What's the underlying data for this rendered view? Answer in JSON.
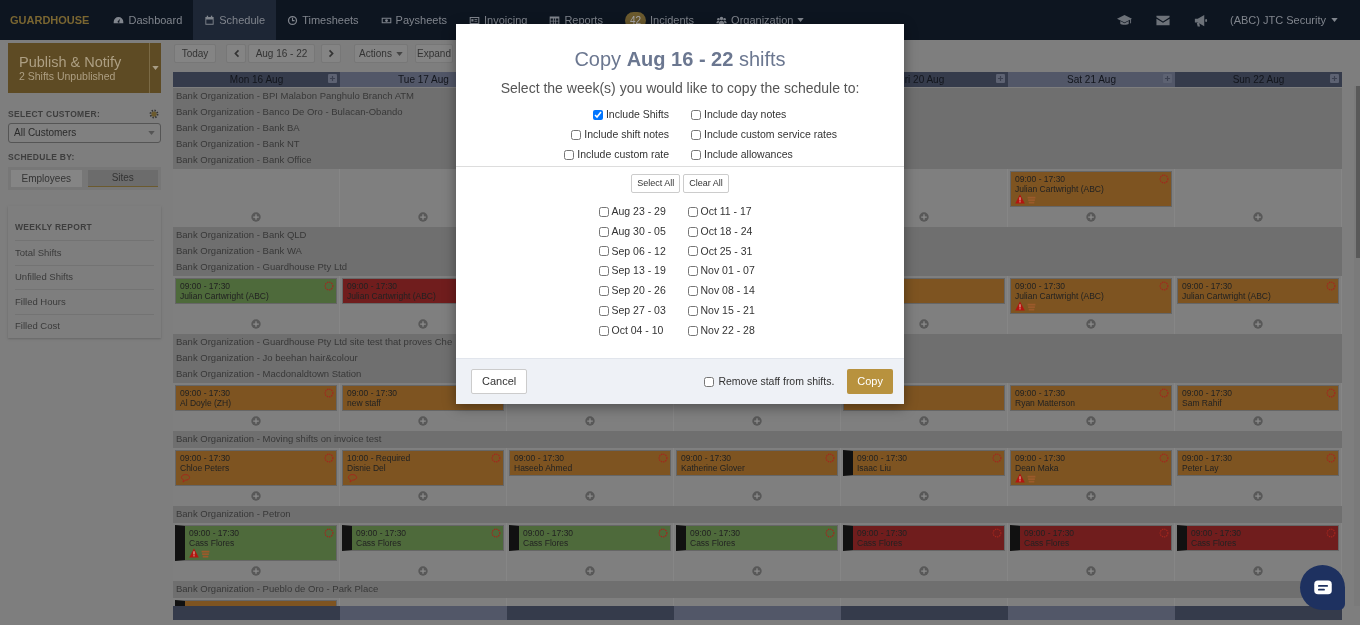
{
  "navbar": {
    "logo": "GUARDHOUSE",
    "items": [
      {
        "label": "Dashboard",
        "selected": false
      },
      {
        "label": "Schedule",
        "selected": true
      },
      {
        "label": "Timesheets",
        "selected": false
      },
      {
        "label": "Paysheets",
        "selected": false
      },
      {
        "label": "Invoicing",
        "selected": false
      },
      {
        "label": "Reports",
        "selected": false
      },
      {
        "label": "Incidents",
        "badge": "42",
        "selected": false
      },
      {
        "label": "Organization",
        "dropdown": true,
        "selected": false
      }
    ],
    "account": "(ABC) JTC Security"
  },
  "sidebar": {
    "publish": {
      "title": "Publish & Notify",
      "subtitle": "2 Shifts Unpublished"
    },
    "customer_label": "SELECT CUSTOMER:",
    "customer_select": "All Customers",
    "schedule_by_label": "SCHEDULE BY:",
    "schedule_by": [
      {
        "label": "Employees",
        "selected": false
      },
      {
        "label": "Sites",
        "selected": true
      }
    ],
    "weekly_report": {
      "title": "WEEKLY REPORT",
      "items": [
        "Total Shifts",
        "Unfilled Shifts",
        "Filled Hours",
        "Filled Cost"
      ]
    }
  },
  "toolbar": {
    "today": "Today",
    "range": "Aug 16 - 22",
    "actions": "Actions",
    "expand": "Expand"
  },
  "schedule": {
    "days_left": [
      {
        "label": "Mon 16 Aug",
        "toggle": true
      },
      {
        "label": "Tue 17 Aug"
      }
    ],
    "days_right": [
      {
        "label": "ri 20 Aug",
        "toggle": true
      },
      {
        "label": "Sat 21 Aug",
        "toggle": true
      },
      {
        "label": "Sun 22 Aug",
        "toggle": true
      }
    ],
    "groups": [
      {
        "sites": [
          "Bank Organization - BPI Malabon Panghulo Branch ATM",
          "Bank Organization - Banco De Oro - Bulacan-Obando",
          "Bank Organization - Bank BA",
          "Bank Organization - Bank NT",
          "Bank Organization - Bank Office"
        ],
        "cells": [
          {
            "add": true
          },
          {
            "add": true
          },
          {},
          {},
          {
            "add": true
          },
          {
            "add": true,
            "shift": {
              "time": "09:00 - 17:30",
              "name": "Julian Cartwright (ABC)",
              "color": "#7e5421",
              "marked": false,
              "warning": true,
              "note": false
            }
          },
          {
            "add": true
          }
        ]
      },
      {
        "sites": [
          "Bank Organization - Bank QLD",
          "Bank Organization - Bank WA",
          "Bank Organization - Guardhouse Pty Ltd"
        ],
        "cells": [
          {
            "add": true,
            "shift": {
              "time": "09:00 - 17:30",
              "name": "Julian Cartwright (ABC)",
              "color": "#4e6a3b",
              "marked": false,
              "warning": false,
              "note": false
            }
          },
          {
            "add": true,
            "shift": {
              "time": "09:00 - 17:30",
              "name": "Julian Cartwright (ABC)",
              "color": "#701d1d",
              "marked": false,
              "warning": false,
              "note": false,
              "flagged": false
            }
          },
          {},
          {},
          {
            "add": true,
            "shift": {
              "color": "#7e5421"
            }
          },
          {
            "add": true,
            "shift": {
              "time": "09:00 - 17:30",
              "name": "Julian Cartwright (ABC)",
              "color": "#7e5421",
              "marked": false,
              "warning": true,
              "note": false
            }
          },
          {
            "add": true,
            "shift": {
              "time": "09:00 - 17:30",
              "name": "Julian Cartwright (ABC)",
              "color": "#7e5421",
              "marked": false,
              "warning": false,
              "note": false
            }
          }
        ]
      },
      {
        "sites": [
          "Bank Organization - Guardhouse Pty Ltd site test that proves Che",
          "Bank Organization - Jo beehan hair&colour",
          "Bank Organization - Macdonaldtown Station"
        ],
        "cells": [
          {
            "add": true,
            "shift": {
              "time": "09:00 - 17:30",
              "name": "Al Doyle (ZH)",
              "color": "#7e5421",
              "marked": false,
              "warning": false,
              "note": false
            }
          },
          {
            "add": true,
            "shift": {
              "time": "09:00 - 17:30",
              "name": "new staff",
              "color": "#7e5421",
              "marked": false,
              "warning": false,
              "note": false,
              "flagged": false
            }
          },
          {
            "add": true
          },
          {
            "add": true
          },
          {
            "add": true,
            "shift": {
              "color": "#7e5421"
            }
          },
          {
            "add": true,
            "shift": {
              "time": "09:00 - 17:30",
              "name": "Ryan Matterson",
              "color": "#7e5421",
              "marked": false,
              "warning": false,
              "note": false
            }
          },
          {
            "add": true,
            "shift": {
              "time": "09:00 - 17:30",
              "name": "Sam Rahif",
              "color": "#7e5421",
              "marked": false,
              "warning": false,
              "note": false
            }
          }
        ]
      },
      {
        "sites": [
          "Bank Organization - Moving shifts on invoice test"
        ],
        "cells": [
          {
            "add": true,
            "shift": {
              "time": "09:00 - 17:30",
              "name": "Chloe Peters",
              "color": "#7e5421",
              "marked": false,
              "warning": false,
              "note": true
            }
          },
          {
            "add": true,
            "shift": {
              "time": "10:00 - Required",
              "name": "Disnie Del",
              "color": "#7e5421",
              "marked": false,
              "warning": false,
              "note": true
            }
          },
          {
            "add": true,
            "shift": {
              "time": "09:00 - 17:30",
              "name": "Haseeb Ahmed",
              "color": "#7e5421",
              "marked": false,
              "warning": false,
              "note": false
            }
          },
          {
            "add": true,
            "shift": {
              "time": "09:00 - 17:30",
              "name": "Katherine Glover",
              "color": "#7e5421",
              "marked": false,
              "warning": false,
              "note": false
            }
          },
          {
            "add": true,
            "shift": {
              "time": "09:00 - 17:30",
              "name": "Isaac Liu",
              "color": "#7e5421",
              "marked": true,
              "warning": false,
              "note": false
            }
          },
          {
            "add": true,
            "shift": {
              "time": "09:00 - 17:30",
              "name": "Dean Maka",
              "color": "#7e5421",
              "marked": false,
              "warning": true,
              "note": false
            }
          },
          {
            "add": true,
            "shift": {
              "time": "09:00 - 17:30",
              "name": "Peter Lay",
              "color": "#7e5421",
              "marked": false,
              "warning": false,
              "note": false
            }
          }
        ]
      },
      {
        "sites": [
          "Bank Organization - Petron"
        ],
        "cells": [
          {
            "add": true,
            "shift": {
              "time": "09:00 - 17:30",
              "name": "Cass Flores",
              "color": "#4e6a3b",
              "marked": true,
              "warning": true,
              "note": false
            }
          },
          {
            "add": true,
            "shift": {
              "time": "09:00 - 17:30",
              "name": "Cass Flores",
              "color": "#4e6a3b",
              "marked": true,
              "warning": false,
              "note": false
            }
          },
          {
            "add": true,
            "shift": {
              "time": "09:00 - 17:30",
              "name": "Cass Flores",
              "color": "#4e6a3b",
              "marked": true,
              "warning": false,
              "note": false
            }
          },
          {
            "add": true,
            "shift": {
              "time": "09:00 - 17:30",
              "name": "Cass Flores",
              "color": "#4e6a3b",
              "marked": true,
              "warning": false,
              "note": false
            }
          },
          {
            "add": true,
            "shift": {
              "time": "09:00 - 17:30",
              "name": "Cass Flores",
              "color": "#701d1d",
              "marked": true,
              "warning": false,
              "note": false
            }
          },
          {
            "add": true,
            "shift": {
              "time": "09:00 - 17:30",
              "name": "Cass Flores",
              "color": "#701d1d",
              "marked": true,
              "warning": false,
              "note": false
            }
          },
          {
            "add": true,
            "shift": {
              "time": "09:00 - 17:30",
              "name": "Cass Flores",
              "color": "#701d1d",
              "marked": true,
              "warning": false,
              "note": false
            }
          }
        ]
      },
      {
        "sites": [
          "Bank Organization - Pueblo de Oro - Park Place"
        ],
        "cells": [
          {
            "shift": {
              "color": "#7e5421",
              "marked": true
            }
          },
          {},
          {},
          {},
          {},
          {},
          {}
        ]
      }
    ]
  },
  "modal": {
    "title": "Copy **Aug 16 - 22** shifts",
    "subtitle": "Select the week(s) you would like to copy the schedule to:",
    "options": [
      {
        "label": "Include Shifts",
        "checked": true
      },
      {
        "label": "Include day notes",
        "checked": false
      },
      {
        "label": "Include shift notes",
        "checked": false
      },
      {
        "label": "Include custom service rates",
        "checked": false
      },
      {
        "label": "Include custom rate",
        "checked": false
      },
      {
        "label": "Include allowances",
        "checked": false
      }
    ],
    "select_all": "Select All",
    "clear_all": "Clear All",
    "weeks": [
      {
        "label": "Aug 23 - 29",
        "checked": false
      },
      {
        "label": "Oct 11 - 17",
        "checked": false
      },
      {
        "label": "Aug 30 - 05",
        "checked": false
      },
      {
        "label": "Oct 18 - 24",
        "checked": false
      },
      {
        "label": "Sep 06 - 12",
        "checked": false
      },
      {
        "label": "Oct 25 - 31",
        "checked": false
      },
      {
        "label": "Sep 13 - 19",
        "checked": false
      },
      {
        "label": "Nov 01 - 07",
        "checked": false
      },
      {
        "label": "Sep 20 - 26",
        "checked": false
      },
      {
        "label": "Nov 08 - 14",
        "checked": false
      },
      {
        "label": "Sep 27 - 03",
        "checked": false
      },
      {
        "label": "Nov 15 - 21",
        "checked": false
      },
      {
        "label": "Oct 04 - 10",
        "checked": false
      },
      {
        "label": "Nov 22 - 28",
        "checked": false
      }
    ],
    "cancel": "Cancel",
    "remove_staff": {
      "label": "Remove staff from shifts.",
      "checked": false
    },
    "copy": "Copy"
  }
}
